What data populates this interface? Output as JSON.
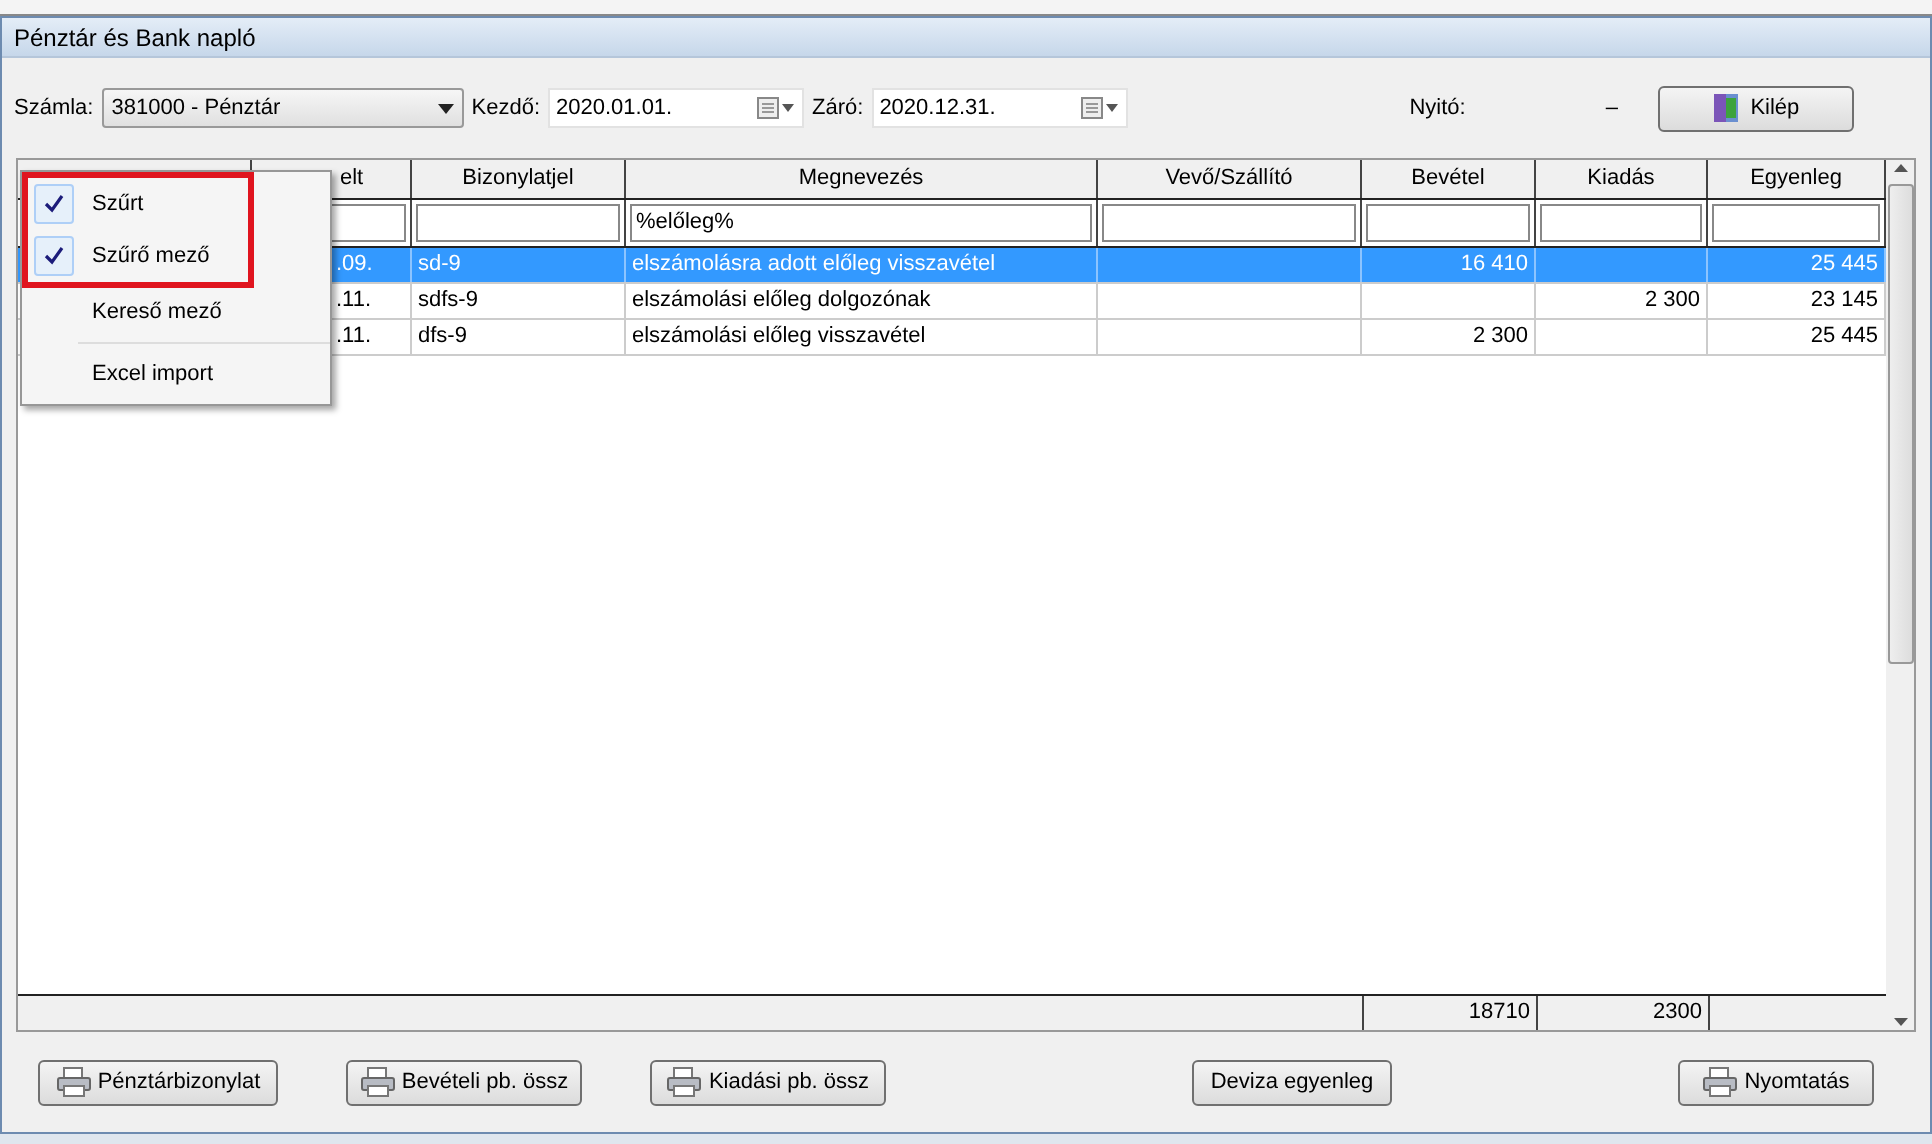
{
  "window": {
    "title": "Pénztár és Bank napló"
  },
  "toolbar": {
    "account_label": "Számla:",
    "account_value": "381000 - Pénztár",
    "start_label": "Kezdő:",
    "start_value": "2020.01.01.",
    "end_label": "Záró:",
    "end_value": "2020.12.31.",
    "opening_label": "Nyitó:",
    "opening_value": "–",
    "exit_button": "Kilép"
  },
  "table": {
    "columns": [
      null,
      "elt",
      "Bizonylatjel",
      "Megnevezés",
      "Vevő/Szállító",
      "Bevétel",
      "Kiadás",
      "Egyenleg"
    ],
    "name_filter": "%előleg%",
    "rows": [
      {
        "selected": true,
        "cells": [
          null,
          ".09.",
          "sd-9",
          "elszámolásra adott előleg visszavétel",
          null,
          "16 410",
          null,
          "25 445"
        ]
      },
      {
        "selected": false,
        "cells": [
          null,
          ".11.",
          "sdfs-9",
          "elszámolási előleg dolgozónak",
          null,
          null,
          "2 300",
          "23 145"
        ]
      },
      {
        "selected": false,
        "cells": [
          null,
          ".11.",
          "dfs-9",
          "elszámolási előleg visszavétel",
          null,
          "2 300",
          null,
          "25 445"
        ]
      }
    ],
    "totals": {
      "income": "18710",
      "expense": "2300"
    }
  },
  "context_menu": {
    "items": [
      {
        "label": "Szűrt",
        "checked": true
      },
      {
        "label": "Szűrő mező",
        "checked": true
      },
      {
        "label": "Kereső mező",
        "checked": false
      },
      {
        "label": "Excel import",
        "checked": false
      }
    ]
  },
  "buttons": [
    {
      "label": "Pénztárbizonylat",
      "icon": true
    },
    {
      "label": "Bevételi pb. össz",
      "icon": true
    },
    {
      "label": "Kiadási pb. össz",
      "icon": true
    },
    {
      "label": "Deviza egyenleg",
      "icon": false
    },
    {
      "label": "Nyomtatás",
      "icon": true
    }
  ]
}
